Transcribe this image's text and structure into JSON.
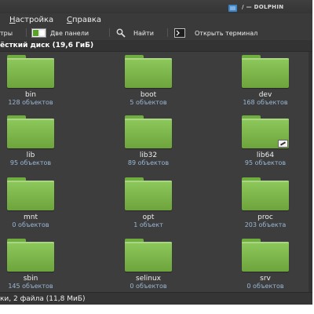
{
  "window": {
    "title": "/ — DOLPHIN"
  },
  "menu": {
    "items": [
      "Настройка",
      "Справка"
    ]
  },
  "toolbar": {
    "filters_label": "тры",
    "split_label": "Две панели",
    "find_label": "Найти",
    "terminal_label": "Открыть терминал"
  },
  "location": {
    "label": "ёсткий диск (19,6 ГиБ)"
  },
  "folders": [
    {
      "name": "bin",
      "count": "128 объектов",
      "link": false
    },
    {
      "name": "boot",
      "count": "5 объектов",
      "link": false
    },
    {
      "name": "dev",
      "count": "168 объектов",
      "link": false
    },
    {
      "name": "lib",
      "count": "95 объектов",
      "link": false
    },
    {
      "name": "lib32",
      "count": "89 объектов",
      "link": false
    },
    {
      "name": "lib64",
      "count": "95 объектов",
      "link": true
    },
    {
      "name": "mnt",
      "count": "0 объектов",
      "link": false
    },
    {
      "name": "opt",
      "count": "1 объект",
      "link": false
    },
    {
      "name": "proc",
      "count": "203 объекта",
      "link": false
    },
    {
      "name": "sbin",
      "count": "145 объектов",
      "link": false
    },
    {
      "name": "selinux",
      "count": "0 объектов",
      "link": false
    },
    {
      "name": "srv",
      "count": "0 объектов",
      "link": false
    }
  ],
  "status": {
    "text": "ки, 2 файла (11,8 МиБ)"
  },
  "colors": {
    "folder_green": "#7fbf4d",
    "background": "#3d3d3d",
    "count_text": "#9ab7d6"
  }
}
